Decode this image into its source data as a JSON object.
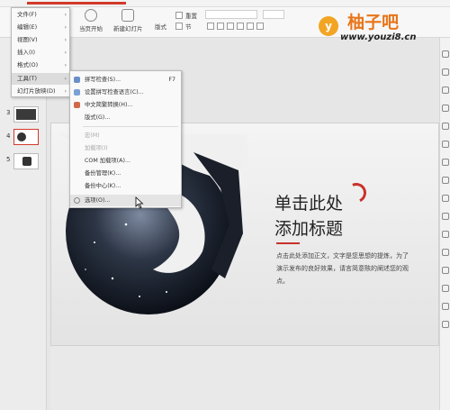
{
  "ribbon": {
    "play_label": "当页开始",
    "new_slide_label": "新建幻灯片",
    "layout_label": "版式",
    "section_label": "节",
    "reset_label": "重置"
  },
  "main_menu": {
    "items": [
      {
        "label": "文件(F)"
      },
      {
        "label": "编辑(E)"
      },
      {
        "label": "视图(V)"
      },
      {
        "label": "插入(I)"
      },
      {
        "label": "格式(O)"
      },
      {
        "label": "工具(T)"
      },
      {
        "label": "幻灯片放映(D)"
      }
    ]
  },
  "tools_menu": {
    "items": [
      {
        "label": "拼写检查(S)...",
        "shortcut": "F7"
      },
      {
        "label": "设置拼写检查语言(C)..."
      },
      {
        "label": "中文简繁转换(H)..."
      },
      {
        "label": "宏(M)",
        "disabled": true
      },
      {
        "label": "加载项(I)",
        "disabled": true
      },
      {
        "label": "COM 加载项(A)..."
      },
      {
        "label": "备份管理(K)..."
      },
      {
        "label": "备份中心(K)..."
      },
      {
        "label": "选项(O)..."
      }
    ],
    "extra_label": "版式(G)..."
  },
  "thumbnails": {
    "numbers": [
      "3",
      "4",
      "5"
    ]
  },
  "slide": {
    "title_line1": "单击此处",
    "title_line2": "添加标题",
    "body": "点击此处添加正文，文字是您思想的提炼，为了演示发布的良好效果，请言简意赅的阐述您的观点。"
  },
  "watermark": {
    "name": "柚子吧",
    "url": "www.youzi8.cn",
    "badge": "y"
  },
  "colors": {
    "accent_red": "#c8322a",
    "logo_orange": "#e8751a",
    "logo_badge": "#f2a524"
  }
}
